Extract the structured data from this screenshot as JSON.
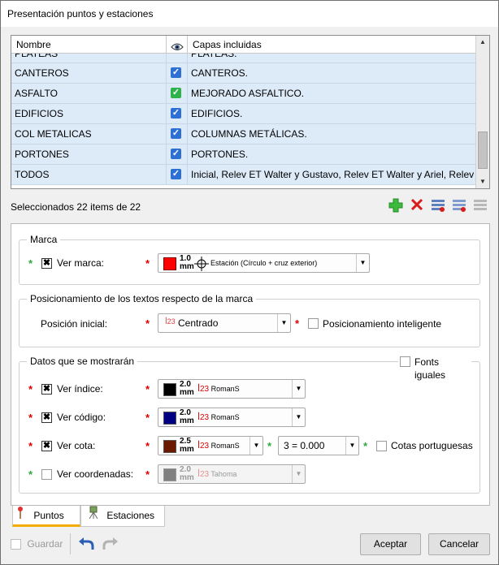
{
  "window": {
    "title": "Presentación puntos y estaciones"
  },
  "table": {
    "headers": {
      "name": "Nombre",
      "layers": "Capas incluidas"
    },
    "rows": [
      {
        "name": "PLATEAS",
        "check": "blue",
        "layers": "PLATEAS."
      },
      {
        "name": "CANTEROS",
        "check": "blue",
        "layers": "CANTEROS."
      },
      {
        "name": "ASFALTO",
        "check": "green",
        "layers": "MEJORADO ASFALTICO."
      },
      {
        "name": "EDIFICIOS",
        "check": "blue",
        "layers": "EDIFICIOS."
      },
      {
        "name": "COL METALICAS",
        "check": "blue",
        "layers": "COLUMNAS METÁLICAS."
      },
      {
        "name": "PORTONES",
        "check": "blue",
        "layers": "PORTONES."
      },
      {
        "name": "TODOS",
        "check": "blue",
        "layers": "Inicial, Relev ET Walter y Gustavo, Relev ET Walter y Ariel, Relev ▾"
      }
    ]
  },
  "selection_info": "Seleccionados 22 items de 22",
  "marca": {
    "legend": "Marca",
    "ver_marca": "Ver marca:",
    "size_value": "1.0",
    "size_unit": "mm",
    "symbol": "Estación (Círculo + cruz exterior)",
    "color": "#ff0000"
  },
  "posicionamiento": {
    "legend": "Posicionamiento de los textos respecto de la marca",
    "posicion_label": "Posición inicial:",
    "posicion_value": "Centrado",
    "inteligente_label": "Posicionamiento inteligente"
  },
  "datos": {
    "legend": "Datos que se mostrarán",
    "fonts_iguales": "Fonts iguales",
    "indice": {
      "label": "Ver índice:",
      "size": "2.0",
      "unit": "mm",
      "font": "RomanS",
      "color": "#000000"
    },
    "codigo": {
      "label": "Ver código:",
      "size": "2.0",
      "unit": "mm",
      "font": "RomanS",
      "color": "#000080"
    },
    "cota": {
      "label": "Ver cota:",
      "size": "2.5",
      "unit": "mm",
      "font": "RomanS",
      "color": "#6b1a00",
      "decimals": "3 = 0.000",
      "portuguesas": "Cotas portuguesas"
    },
    "coordenadas": {
      "label": "Ver coordenadas:",
      "size": "2.0",
      "unit": "mm",
      "font": "Tahoma",
      "color": "#808080"
    }
  },
  "tabs": {
    "puntos": "Puntos",
    "estaciones": "Estaciones"
  },
  "footer": {
    "guardar": "Guardar",
    "aceptar": "Aceptar",
    "cancelar": "Cancelar"
  }
}
